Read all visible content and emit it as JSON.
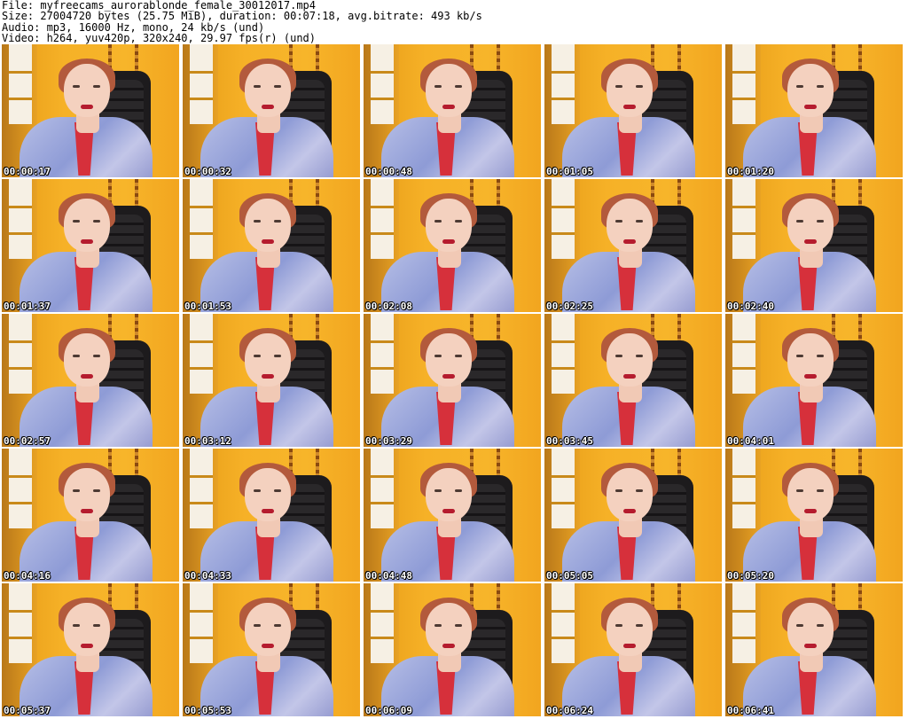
{
  "header": {
    "file_line": "File: myfreecams_aurorablonde_female_30012017.mp4",
    "size_line": "Size: 27004720 bytes (25.75 MiB), duration: 00:07:18, avg.bitrate: 493 kb/s",
    "audio_line": "Audio: mp3, 16000 Hz, mono, 24 kb/s (und)",
    "video_line": "Video: h264, yuv420p, 320x240, 29.97 fps(r) (und)"
  },
  "thumbnails": [
    {
      "timestamp": "00:00:17"
    },
    {
      "timestamp": "00:00:32"
    },
    {
      "timestamp": "00:00:48"
    },
    {
      "timestamp": "00:01:05"
    },
    {
      "timestamp": "00:01:20"
    },
    {
      "timestamp": "00:01:37"
    },
    {
      "timestamp": "00:01:53"
    },
    {
      "timestamp": "00:02:08"
    },
    {
      "timestamp": "00:02:25"
    },
    {
      "timestamp": "00:02:40"
    },
    {
      "timestamp": "00:02:57"
    },
    {
      "timestamp": "00:03:12"
    },
    {
      "timestamp": "00:03:29"
    },
    {
      "timestamp": "00:03:45"
    },
    {
      "timestamp": "00:04:01"
    },
    {
      "timestamp": "00:04:16"
    },
    {
      "timestamp": "00:04:33"
    },
    {
      "timestamp": "00:04:48"
    },
    {
      "timestamp": "00:05:05"
    },
    {
      "timestamp": "00:05:20"
    },
    {
      "timestamp": "00:05:37"
    },
    {
      "timestamp": "00:05:53"
    },
    {
      "timestamp": "00:06:09"
    },
    {
      "timestamp": "00:06:24"
    },
    {
      "timestamp": "00:06:41"
    }
  ]
}
